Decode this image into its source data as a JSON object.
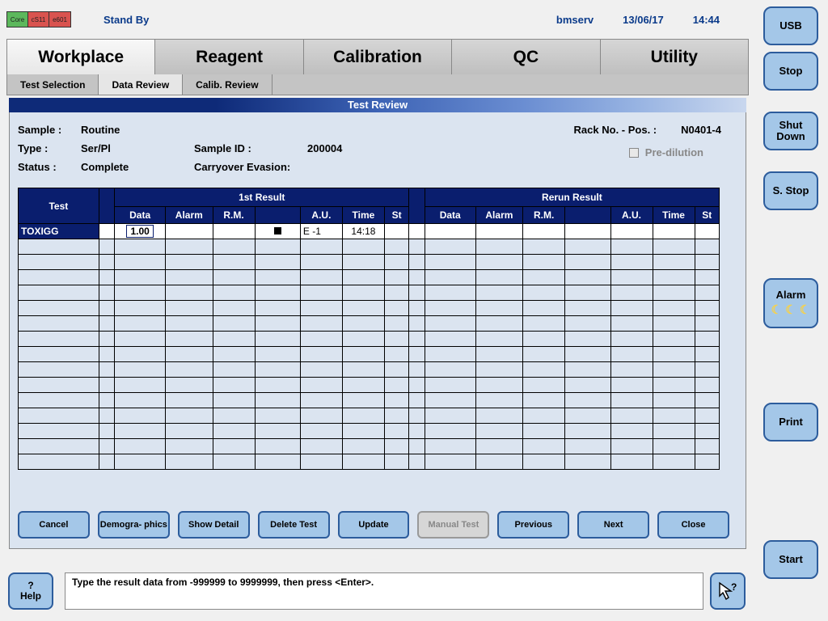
{
  "header": {
    "modules": [
      "Core",
      "cS11",
      "e601"
    ],
    "status": "Stand By",
    "user": "bmserv",
    "date": "13/06/17",
    "time": "14:44"
  },
  "side_buttons": {
    "usb": "USB",
    "stop": "Stop",
    "shut_down": "Shut Down",
    "s_stop": "S. Stop",
    "alarm": "Alarm",
    "print": "Print",
    "start": "Start"
  },
  "main_tabs": [
    "Workplace",
    "Reagent",
    "Calibration",
    "QC",
    "Utility"
  ],
  "active_main_tab": 0,
  "sub_tabs": [
    "Test Selection",
    "Data Review",
    "Calib. Review"
  ],
  "active_sub_tab": 1,
  "panel_title": "Test Review",
  "info": {
    "sample_label": "Sample :",
    "sample_value": "Routine",
    "type_label": "Type :",
    "type_value": "Ser/Pl",
    "status_label": "Status :",
    "status_value": "Complete",
    "sample_id_label": "Sample ID :",
    "sample_id_value": "200004",
    "carryover_label": "Carryover Evasion:",
    "rack_label": "Rack No. - Pos. :",
    "rack_value": "N0401-4",
    "pre_dilution_label": "Pre-dilution"
  },
  "table": {
    "group_headers": {
      "test": "Test",
      "first": "1st Result",
      "rerun": "Rerun Result"
    },
    "columns": [
      "Data",
      "Alarm",
      "R.M.",
      "",
      "A.U.",
      "Time",
      "St"
    ],
    "rows": [
      {
        "test": "TOXIGG",
        "first": {
          "data": "1.00",
          "alarm": "",
          "rm": "",
          "col4_marker": true,
          "au": "E -1",
          "time": "14:18",
          "st": ""
        },
        "rerun": {
          "data": "",
          "alarm": "",
          "rm": "",
          "col4_marker": false,
          "au": "",
          "time": "",
          "st": ""
        }
      }
    ],
    "empty_row_count": 15
  },
  "lower_buttons": {
    "cancel": "Cancel",
    "demographics": "Demogra-\nphics",
    "show_detail": "Show Detail",
    "delete_test": "Delete Test",
    "update": "Update",
    "manual_test": "Manual Test",
    "previous": "Previous",
    "next": "Next",
    "close": "Close"
  },
  "help_button": "? Help",
  "hint_text": "Type the result data from -999999 to 9999999, then press <Enter>.",
  "cursor_glyph": "↖?"
}
